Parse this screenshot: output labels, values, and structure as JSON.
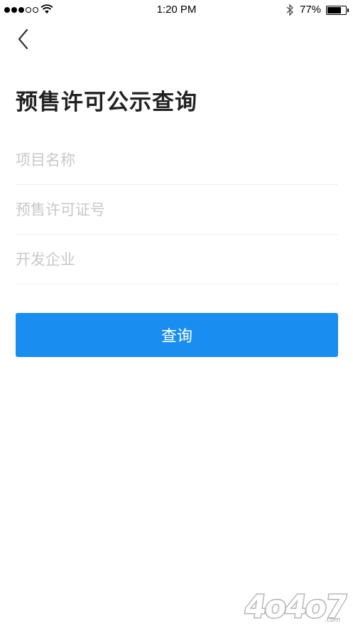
{
  "status_bar": {
    "signal_full": 3,
    "signal_total": 5,
    "time": "1:20 PM",
    "battery_percent": "77%",
    "battery_level": 0.77
  },
  "nav": {
    "back_icon": "chevron-left-icon"
  },
  "page": {
    "title": "预售许可公示查询"
  },
  "form": {
    "project_name_placeholder": "项目名称",
    "project_name_value": "",
    "permit_number_placeholder": "预售许可证号",
    "permit_number_value": "",
    "developer_placeholder": "开发企业",
    "developer_value": "",
    "submit_label": "查询"
  },
  "colors": {
    "accent": "#1a8ef0",
    "title_text": "#222222",
    "placeholder": "#c8c8c8",
    "divider": "#eeeeee"
  },
  "watermark": {
    "text": "4o4o7.com"
  }
}
